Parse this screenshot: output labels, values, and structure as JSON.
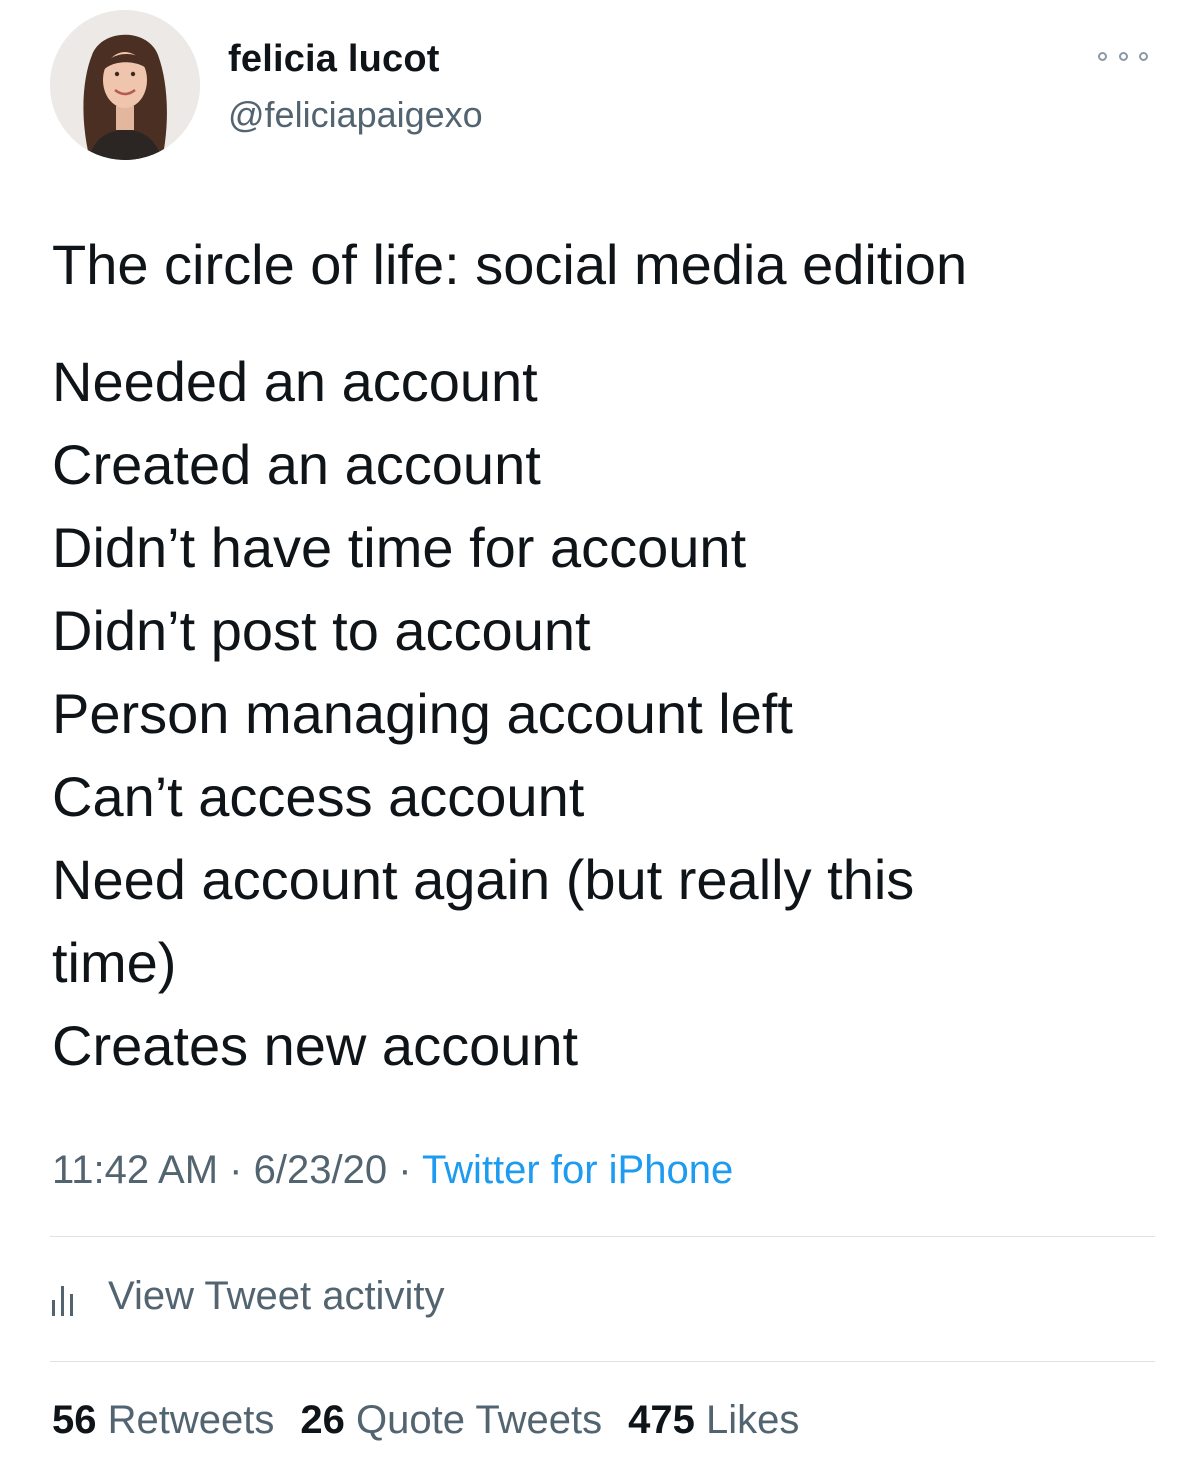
{
  "author": {
    "display_name": "felicia lucot",
    "handle": "@feliciapaigexo",
    "avatar_icon": "profile-photo"
  },
  "more_icon": "ellipsis-icon",
  "tweet": {
    "title": "The circle of life: social media edition",
    "lines": [
      "Needed an account",
      "Created an account",
      "Didn’t have time for account",
      "Didn’t post to account",
      "Person managing account left",
      "Can’t access account",
      "Need account again (but really this",
      "time)",
      "Creates new account"
    ]
  },
  "meta": {
    "time": "11:42 AM",
    "separator": "·",
    "date": "6/23/20",
    "source": "Twitter for iPhone"
  },
  "activity": {
    "label": "View Tweet activity",
    "icon": "bar-chart-icon"
  },
  "stats": {
    "retweets_count": "56",
    "retweets_label": "Retweets",
    "quotes_count": "26",
    "quotes_label": "Quote Tweets",
    "likes_count": "475",
    "likes_label": "Likes"
  },
  "colors": {
    "text": "#0f1419",
    "secondary": "#536471",
    "link": "#1d9bf0",
    "divider": "#dfe3e6"
  }
}
